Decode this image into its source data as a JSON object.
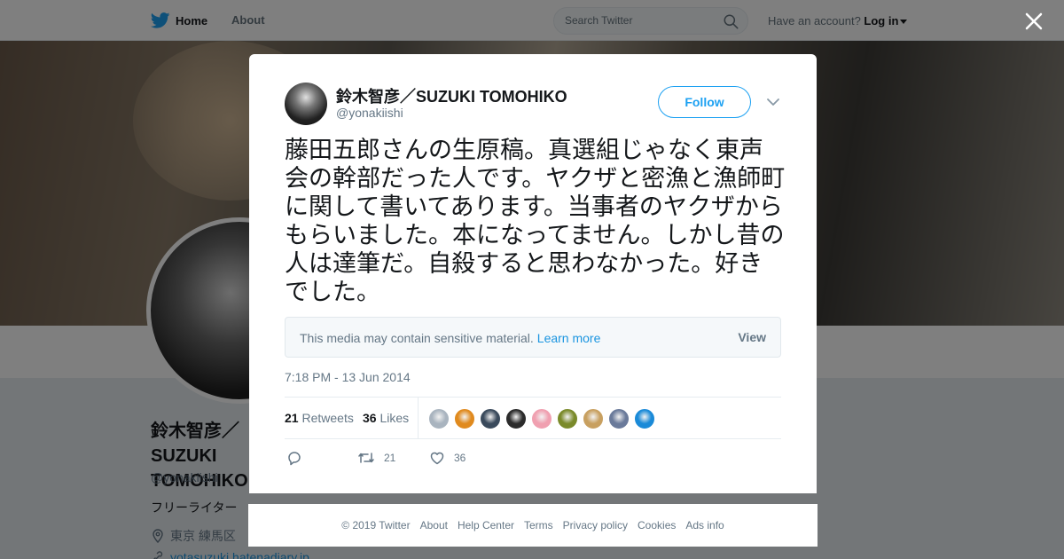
{
  "nav": {
    "home": "Home",
    "about": "About",
    "search_placeholder": "Search Twitter",
    "have_account": "Have an account?",
    "login": "Log in"
  },
  "profile": {
    "name": "鈴木智彦／SUZUKI TOMOHIKO",
    "handle": "@yonakiishi",
    "bio": "フリーライター",
    "location": "東京 練馬区",
    "url": "yotasuzuki.hatenadiary.jp"
  },
  "tweet": {
    "author_name": "鈴木智彦／SUZUKI TOMOHIKO",
    "author_handle": "@yonakiishi",
    "follow_label": "Follow",
    "text": "藤田五郎さんの生原稿。真選組じゃなく東声会の幹部だった人です。ヤクザと密漁と漁師町に関して書いてあります。当事者のヤクザからもらいました。本になってません。しかし昔の人は達筆だ。自殺すると思わなかった。好きでした。",
    "sensitive_text": "This media may contain sensitive material.",
    "learn_more": "Learn more",
    "view": "View",
    "timestamp": "7:18 PM - 13 Jun 2014",
    "retweets_count": "21",
    "retweets_label": "Retweets",
    "likes_count": "36",
    "likes_label": "Likes",
    "action_retweets": "21",
    "action_likes": "36",
    "liker_colors": [
      "#a9b4bf",
      "#e08a1e",
      "#3a4a5c",
      "#2b2b2b",
      "#f0a0b0",
      "#7a8a2a",
      "#c8a060",
      "#6a7a9a",
      "#1a8ad8"
    ]
  },
  "footer": {
    "copyright": "© 2019 Twitter",
    "about": "About",
    "help": "Help Center",
    "terms": "Terms",
    "privacy": "Privacy policy",
    "cookies": "Cookies",
    "ads": "Ads info"
  },
  "colors": {
    "brand": "#1da1f2",
    "link": "#1b95e0",
    "secondary_text": "#657786"
  }
}
